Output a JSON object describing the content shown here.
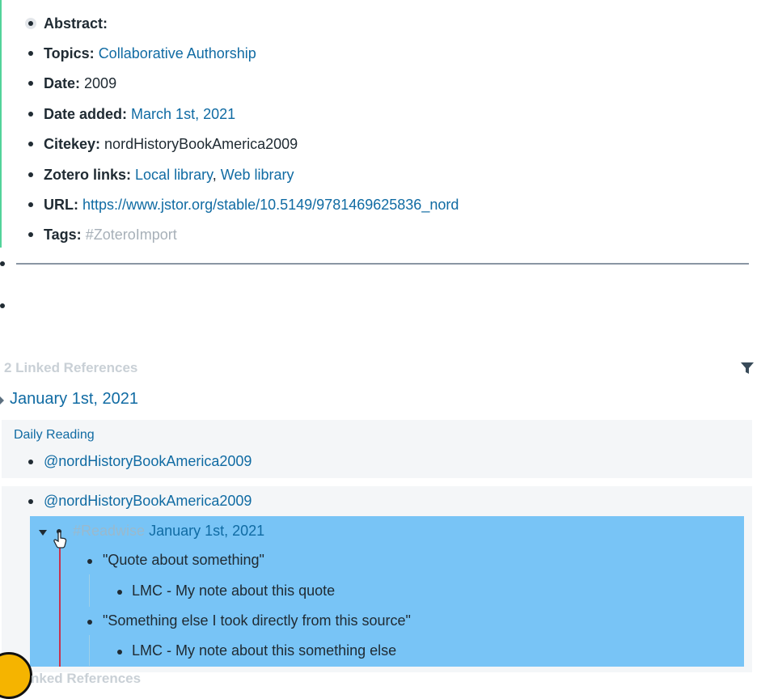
{
  "properties": {
    "abstract": {
      "key": "Abstract:"
    },
    "topics": {
      "key": "Topics:",
      "value": "Collaborative Authorship"
    },
    "date": {
      "key": "Date:",
      "value": "2009"
    },
    "date_added": {
      "key": "Date added:",
      "value": "March 1st, 2021"
    },
    "citekey": {
      "key": "Citekey:",
      "value": "nordHistoryBookAmerica2009"
    },
    "zotero": {
      "key": "Zotero links:",
      "local": "Local library",
      "sep": ",",
      "web": "Web library"
    },
    "url": {
      "key": "URL:",
      "value": "https://www.jstor.org/stable/10.5149/9781469625836_nord"
    },
    "tags": {
      "key": "Tags:",
      "value": "#ZoteroImport"
    }
  },
  "linked_refs": {
    "header": "2 Linked References",
    "group_title": "January 1st, 2021",
    "card1": {
      "breadcrumb": "Daily Reading",
      "item": "@nordHistoryBookAmerica2009"
    },
    "card2": {
      "item": "@nordHistoryBookAmerica2009",
      "readwise_tag": "#Readwise",
      "readwise_date": "January 1st, 2021",
      "quote1": "\"Quote about something\"",
      "note1": "LMC - My note about this quote",
      "quote2": "\"Something else I took directly from this source\"",
      "note2": "LMC - My note about this something else"
    },
    "bottom_header": "nked References"
  },
  "icons": {
    "filter": "filter-icon",
    "cursor": "hand-pointer-icon"
  },
  "colors": {
    "link": "#106ba3",
    "highlight": "#78c4f6",
    "accent_bar": "#53d39a"
  }
}
